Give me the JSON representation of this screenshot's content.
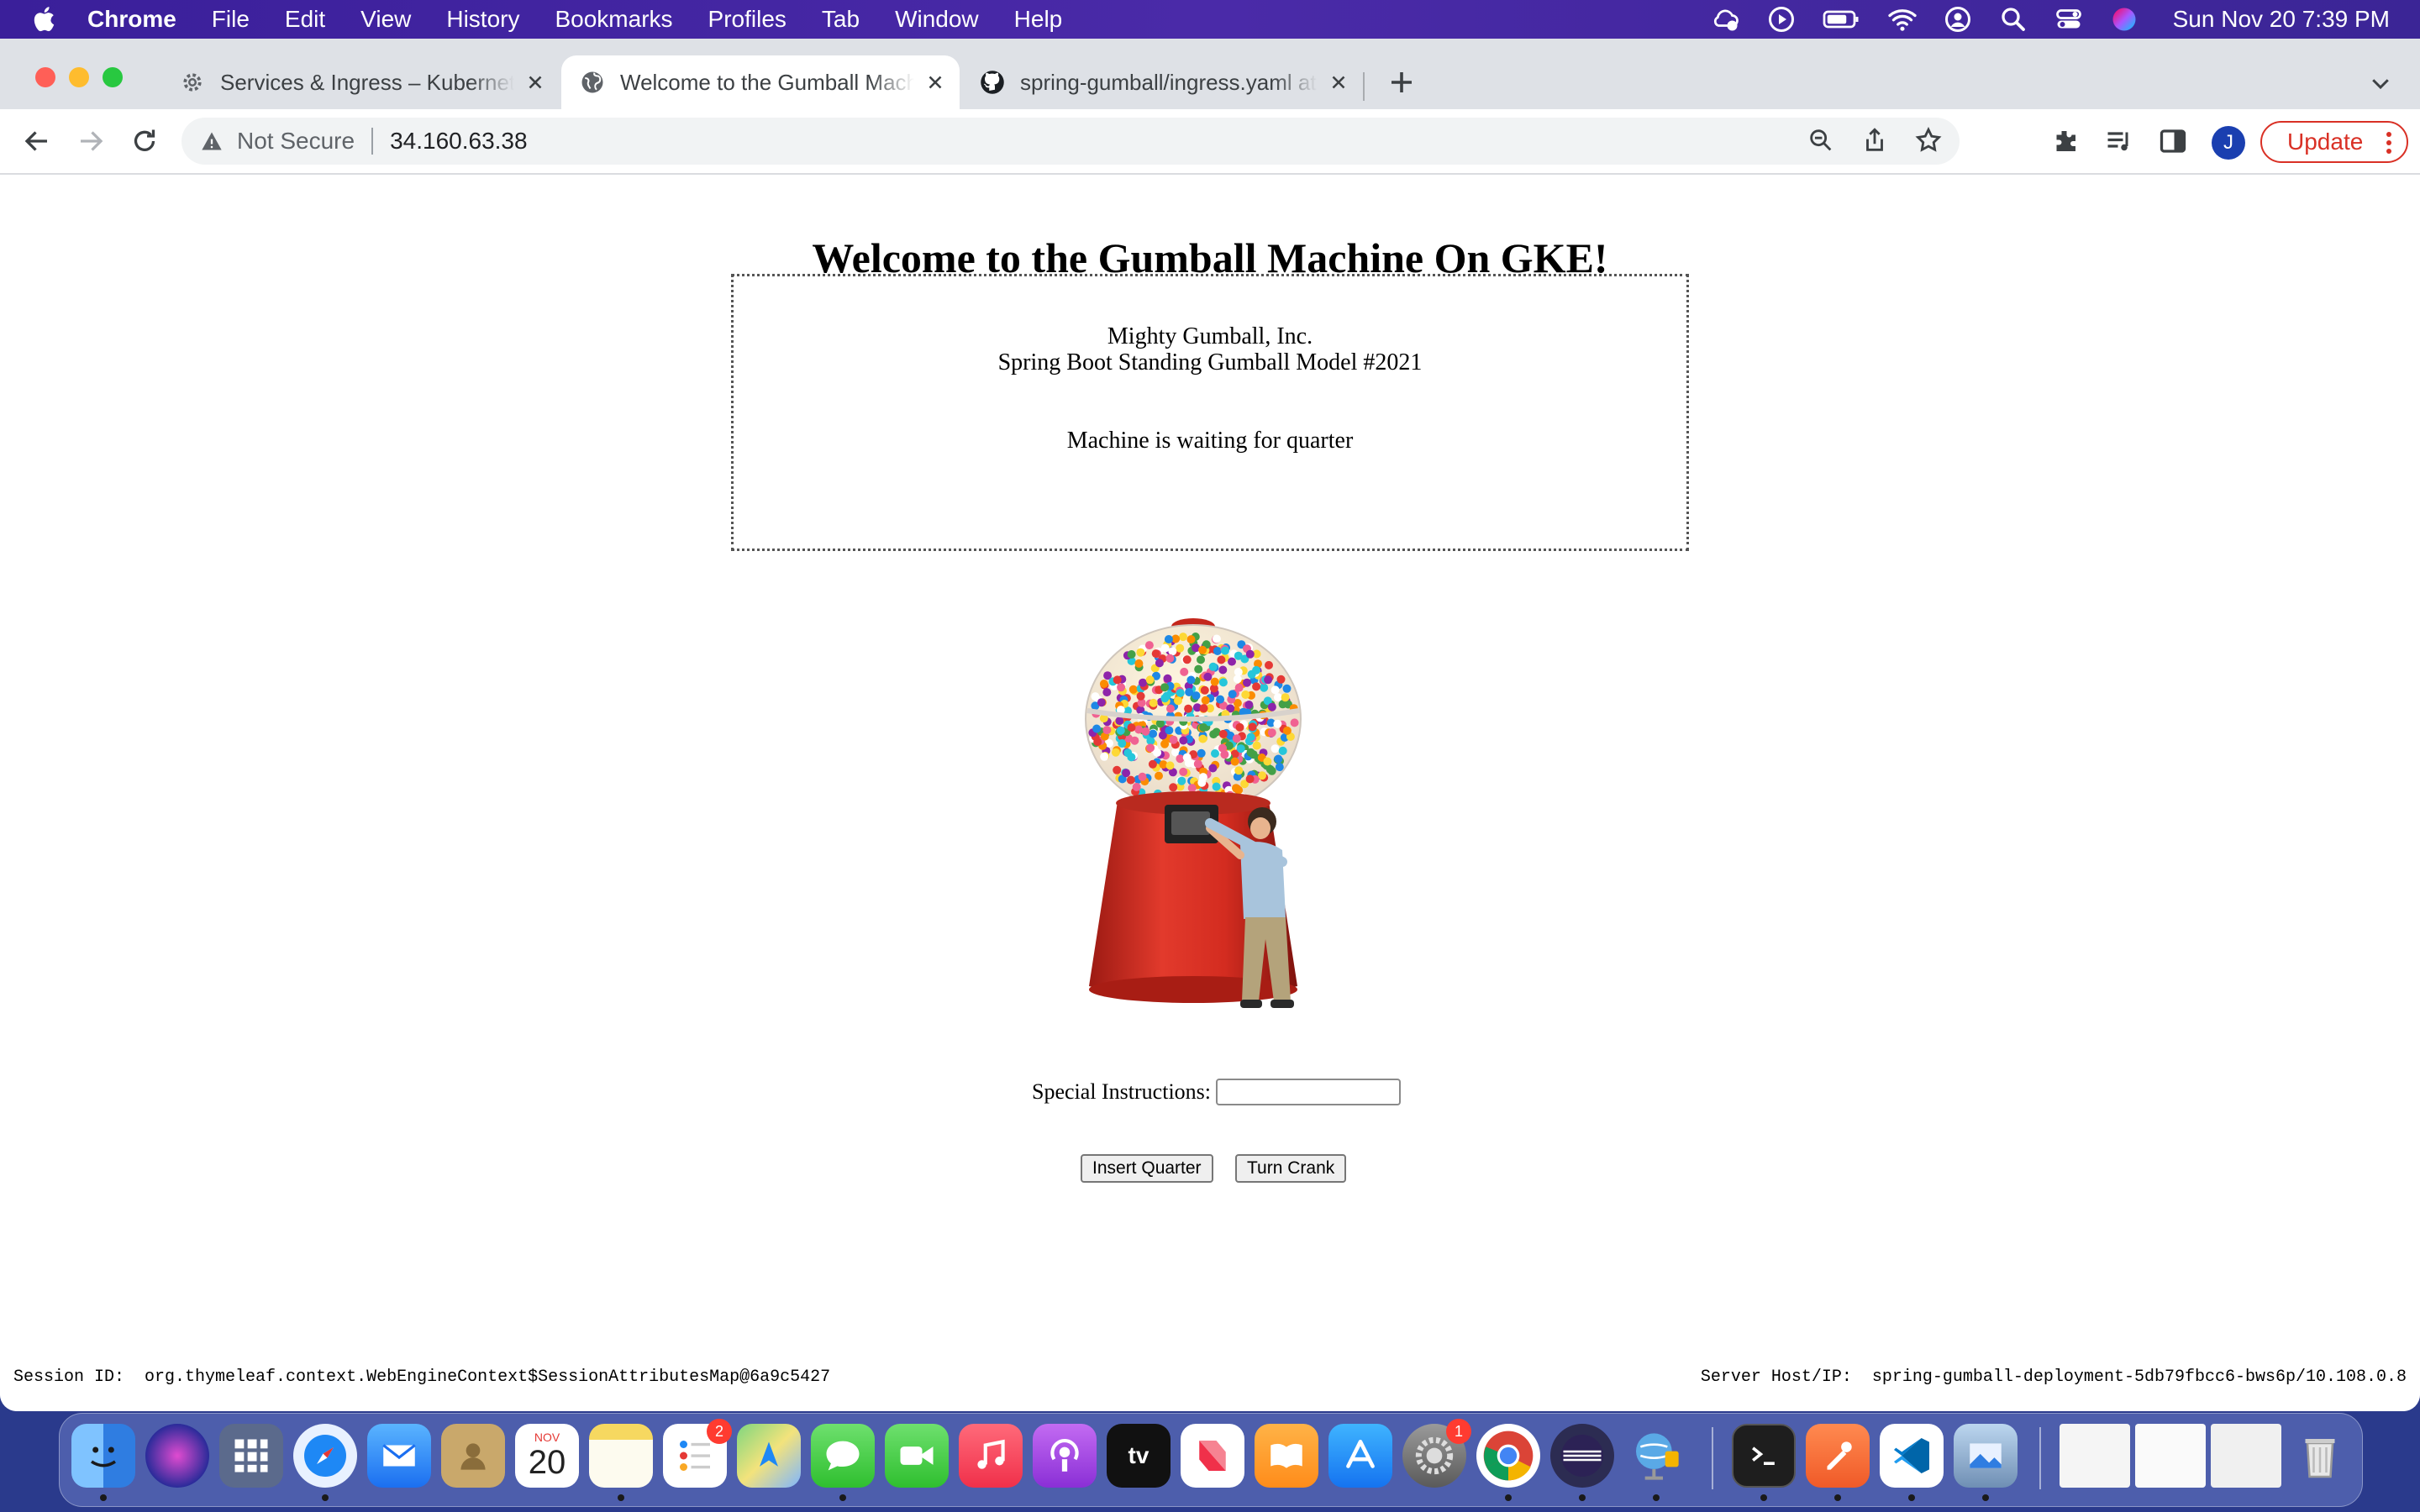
{
  "menubar": {
    "app_name": "Chrome",
    "menus": [
      "File",
      "Edit",
      "View",
      "History",
      "Bookmarks",
      "Profiles",
      "Tab",
      "Window",
      "Help"
    ],
    "clock": "Sun Nov 20  7:39 PM"
  },
  "tabs": [
    {
      "title": "Services & Ingress – Kubernetes",
      "icon": "gear-icon",
      "active": false
    },
    {
      "title": "Welcome to the Gumball Machine",
      "icon": "globe-icon",
      "active": true
    },
    {
      "title": "spring-gumball/ingress.yaml at",
      "icon": "github-icon",
      "active": false
    }
  ],
  "toolbar": {
    "security_label": "Not Secure",
    "url": "34.160.63.38",
    "profile_initial": "J",
    "update_label": "Update"
  },
  "page": {
    "heading": "Welcome to the Gumball Machine On GKE!",
    "company": "Mighty Gumball, Inc.",
    "model": "Spring Boot Standing Gumball Model #2021",
    "status": "Machine is waiting for quarter",
    "instructions_label": "Special Instructions:",
    "instructions_value": "",
    "insert_quarter_label": "Insert Quarter",
    "turn_crank_label": "Turn Crank",
    "session_text": "Session ID:  org.thymeleaf.context.WebEngineContext$SessionAttributesMap@6a9c5427",
    "server_text": "Server Host/IP:  spring-gumball-deployment-5db79fbcc6-bws6p/10.108.0.8"
  },
  "dock": {
    "calendar_month": "NOV",
    "calendar_day": "20",
    "reminders_badge": "2",
    "settings_badge": "1",
    "tv_label": "tv"
  },
  "colors": {
    "menubar": "#3f229e",
    "update_red": "#d93025",
    "avatar_blue": "#1a3fb0"
  }
}
